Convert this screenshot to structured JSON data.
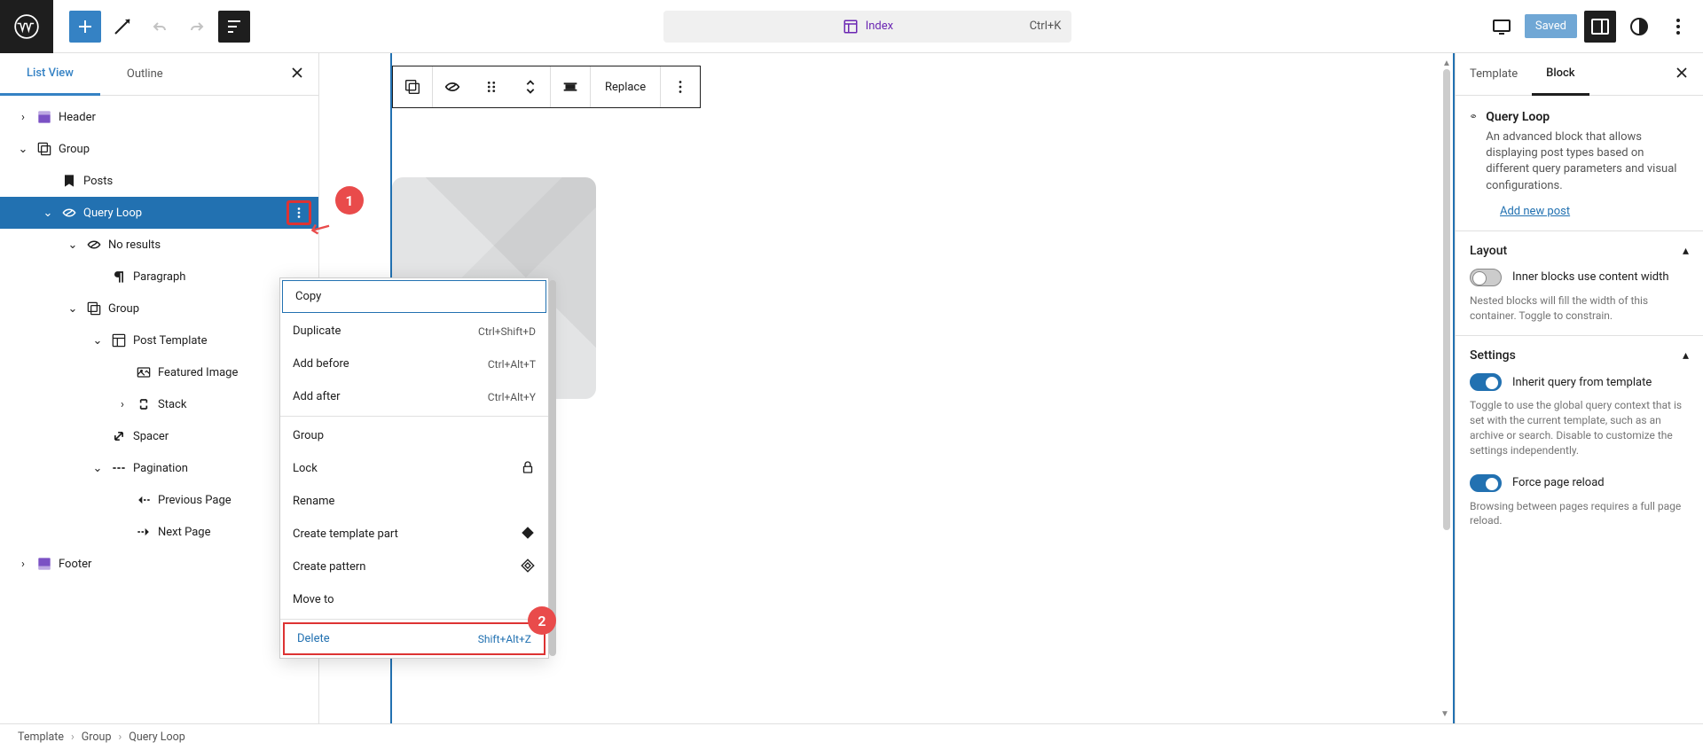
{
  "topbar": {
    "center_label": "Index",
    "center_shortcut": "Ctrl+K",
    "saved_label": "Saved"
  },
  "left_panel": {
    "tabs": {
      "list_view": "List View",
      "outline": "Outline"
    },
    "tree": [
      {
        "label": "Header",
        "indent": 0,
        "chev": "right",
        "icon": "header",
        "selected": false
      },
      {
        "label": "Group",
        "indent": 0,
        "chev": "down",
        "icon": "group",
        "selected": false
      },
      {
        "label": "Posts",
        "indent": 1,
        "chev": "",
        "icon": "posts",
        "selected": false
      },
      {
        "label": "Query Loop",
        "indent": 1,
        "chev": "down",
        "icon": "loop",
        "selected": true,
        "more": true
      },
      {
        "label": "No results",
        "indent": 2,
        "chev": "down",
        "icon": "loop",
        "selected": false
      },
      {
        "label": "Paragraph",
        "indent": 3,
        "chev": "",
        "icon": "para",
        "selected": false
      },
      {
        "label": "Group",
        "indent": 2,
        "chev": "down",
        "icon": "group",
        "selected": false
      },
      {
        "label": "Post Template",
        "indent": 3,
        "chev": "down",
        "icon": "layout",
        "selected": false
      },
      {
        "label": "Featured Image",
        "indent": 4,
        "chev": "",
        "icon": "image",
        "selected": false
      },
      {
        "label": "Stack",
        "indent": 4,
        "chev": "right",
        "icon": "stack",
        "selected": false
      },
      {
        "label": "Spacer",
        "indent": 3,
        "chev": "",
        "icon": "spacer",
        "selected": false
      },
      {
        "label": "Pagination",
        "indent": 3,
        "chev": "down",
        "icon": "pagination",
        "selected": false
      },
      {
        "label": "Previous Page",
        "indent": 4,
        "chev": "",
        "icon": "prev",
        "selected": false
      },
      {
        "label": "Next Page",
        "indent": 4,
        "chev": "",
        "icon": "next",
        "selected": false
      },
      {
        "label": "Footer",
        "indent": 0,
        "chev": "right",
        "icon": "footer",
        "selected": false
      }
    ]
  },
  "block_toolbar": {
    "replace_label": "Replace"
  },
  "context_menu": [
    {
      "label": "Copy",
      "shortcut": "",
      "first": true
    },
    {
      "label": "Duplicate",
      "shortcut": "Ctrl+Shift+D"
    },
    {
      "label": "Add before",
      "shortcut": "Ctrl+Alt+T"
    },
    {
      "label": "Add after",
      "shortcut": "Ctrl+Alt+Y"
    },
    {
      "sep": true
    },
    {
      "label": "Group",
      "shortcut": ""
    },
    {
      "label": "Lock",
      "shortcut": "",
      "icon": "lock"
    },
    {
      "label": "Rename",
      "shortcut": ""
    },
    {
      "label": "Create template part",
      "shortcut": "",
      "icon": "diamond-fill"
    },
    {
      "label": "Create pattern",
      "shortcut": "",
      "icon": "diamond-outline"
    },
    {
      "label": "Move to",
      "shortcut": ""
    },
    {
      "sep": true
    },
    {
      "label": "Delete",
      "shortcut": "Shift+Alt+Z",
      "delete": true
    }
  ],
  "right_panel": {
    "tabs": {
      "template": "Template",
      "block": "Block"
    },
    "block_title": "Query Loop",
    "block_desc": "An advanced block that allows displaying post types based on different query parameters and visual configurations.",
    "add_post_link": "Add new post",
    "layout_header": "Layout",
    "layout_label": "Inner blocks use content width",
    "layout_help": "Nested blocks will fill the width of this container. Toggle to constrain.",
    "settings_header": "Settings",
    "inherit_label": "Inherit query from template",
    "inherit_help": "Toggle to use the global query context that is set with the current template, such as an archive or search. Disable to customize the settings independently.",
    "force_label": "Force page reload",
    "force_help": "Browsing between pages requires a full page reload."
  },
  "breadcrumb": [
    "Template",
    "Group",
    "Query Loop"
  ],
  "annotations": {
    "one": "1",
    "two": "2"
  }
}
